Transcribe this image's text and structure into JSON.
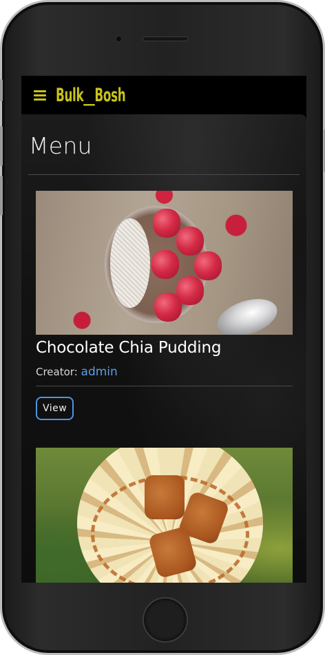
{
  "app": {
    "brand": "Bulk__Bosh"
  },
  "page": {
    "title": "Menu"
  },
  "recipes": [
    {
      "title": "Chocolate Chia Pudding",
      "creator_label": "Creator:",
      "creator": "admin",
      "view_label": "View"
    },
    {
      "title": "",
      "creator_label": "",
      "creator": "",
      "view_label": ""
    }
  ],
  "colors": {
    "brand": "#c7c31b",
    "link": "#5a9fe6",
    "button_border": "#4d95e6",
    "navbar_bg": "#000000"
  },
  "icons": {
    "menu": "hamburger-icon"
  }
}
